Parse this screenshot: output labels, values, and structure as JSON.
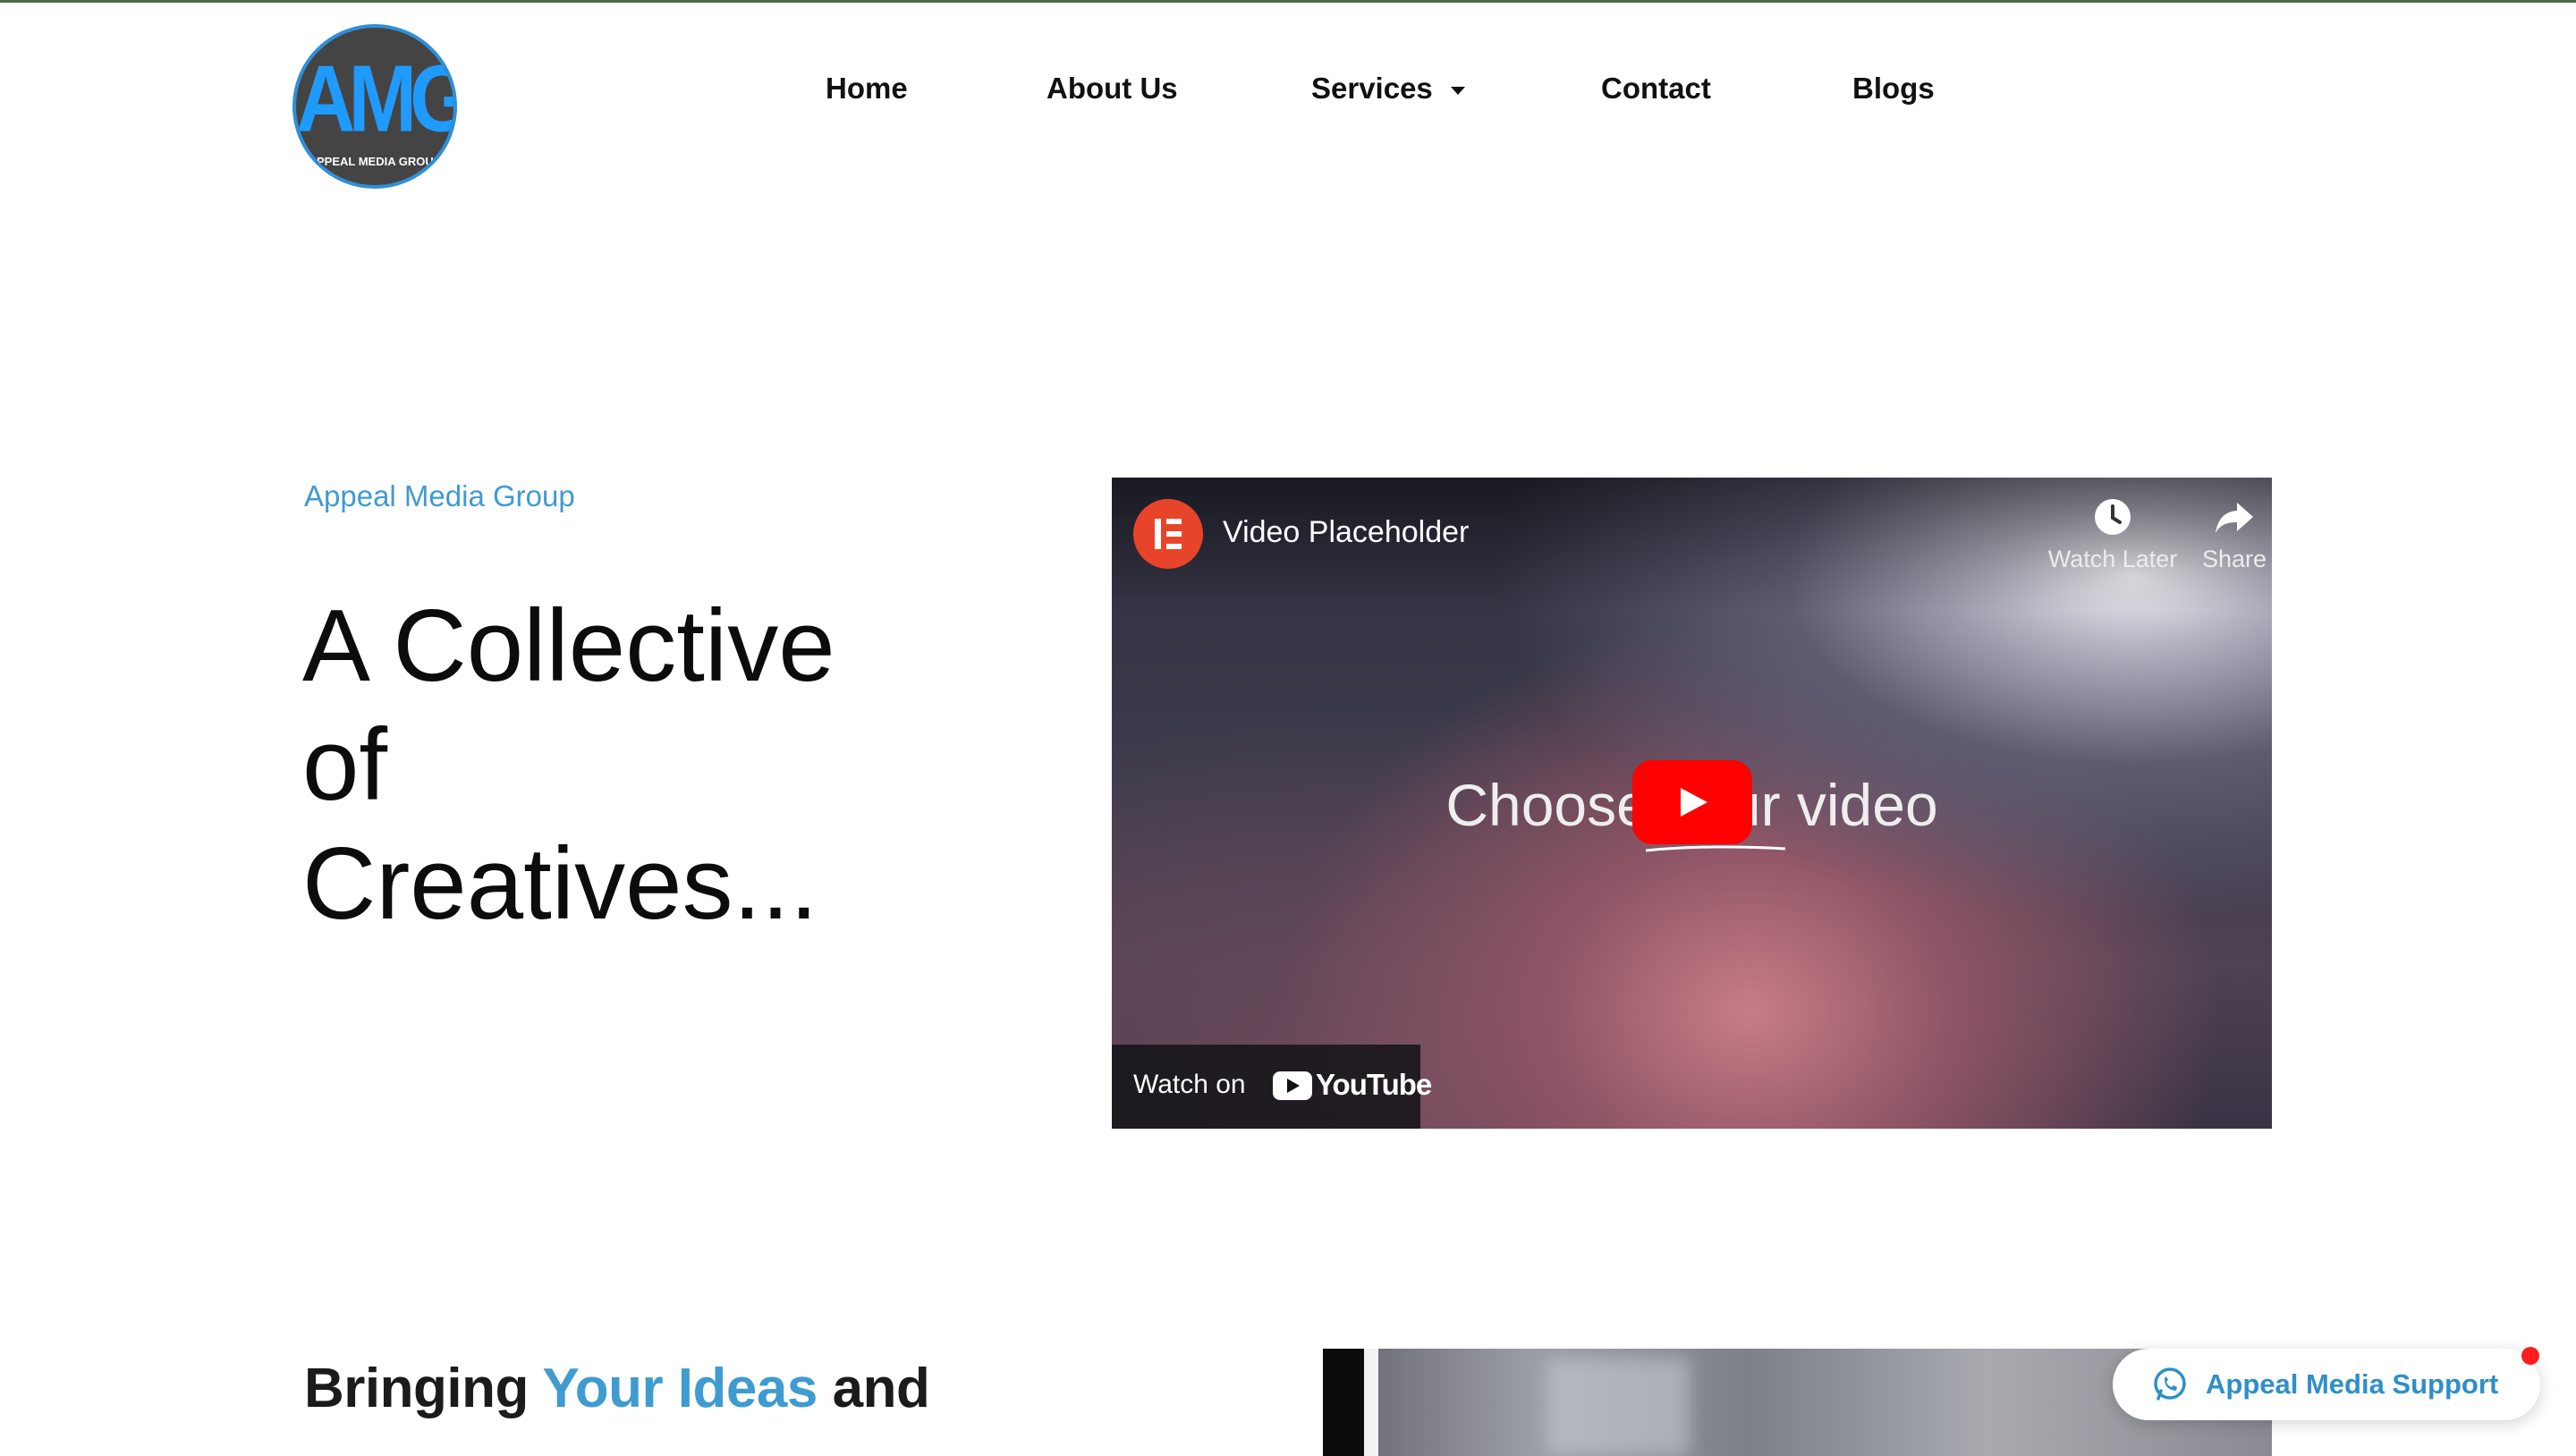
{
  "brand": {
    "logo_mark": "AMG",
    "logo_subtext": "APPEAL MEDIA GROUP",
    "colors": {
      "accent": "#3f9bd0",
      "logo_blue": "#1f9bff",
      "logo_bg": "#444444",
      "youtube_red": "#ff0000"
    }
  },
  "nav": {
    "items": [
      {
        "label": "Home"
      },
      {
        "label": "About Us"
      },
      {
        "label": "Services",
        "has_dropdown": true
      },
      {
        "label": "Contact"
      },
      {
        "label": "Blogs"
      }
    ]
  },
  "hero": {
    "eyebrow": "Appeal Media Group",
    "title_lines": [
      "A Collective",
      "of",
      "Creatives..."
    ]
  },
  "video": {
    "channel_icon": "elementor-icon",
    "title": "Video Placeholder",
    "watch_later_label": "Watch Later",
    "share_label": "Share",
    "center_text": "Choose your video",
    "watch_on_label": "Watch on",
    "youtube_label": "YouTube"
  },
  "section2": {
    "title_prefix": "Bringing ",
    "title_highlight": "Your Ideas",
    "title_suffix": " and"
  },
  "support": {
    "label": "Appeal Media Support",
    "icon": "whatsapp-icon"
  }
}
